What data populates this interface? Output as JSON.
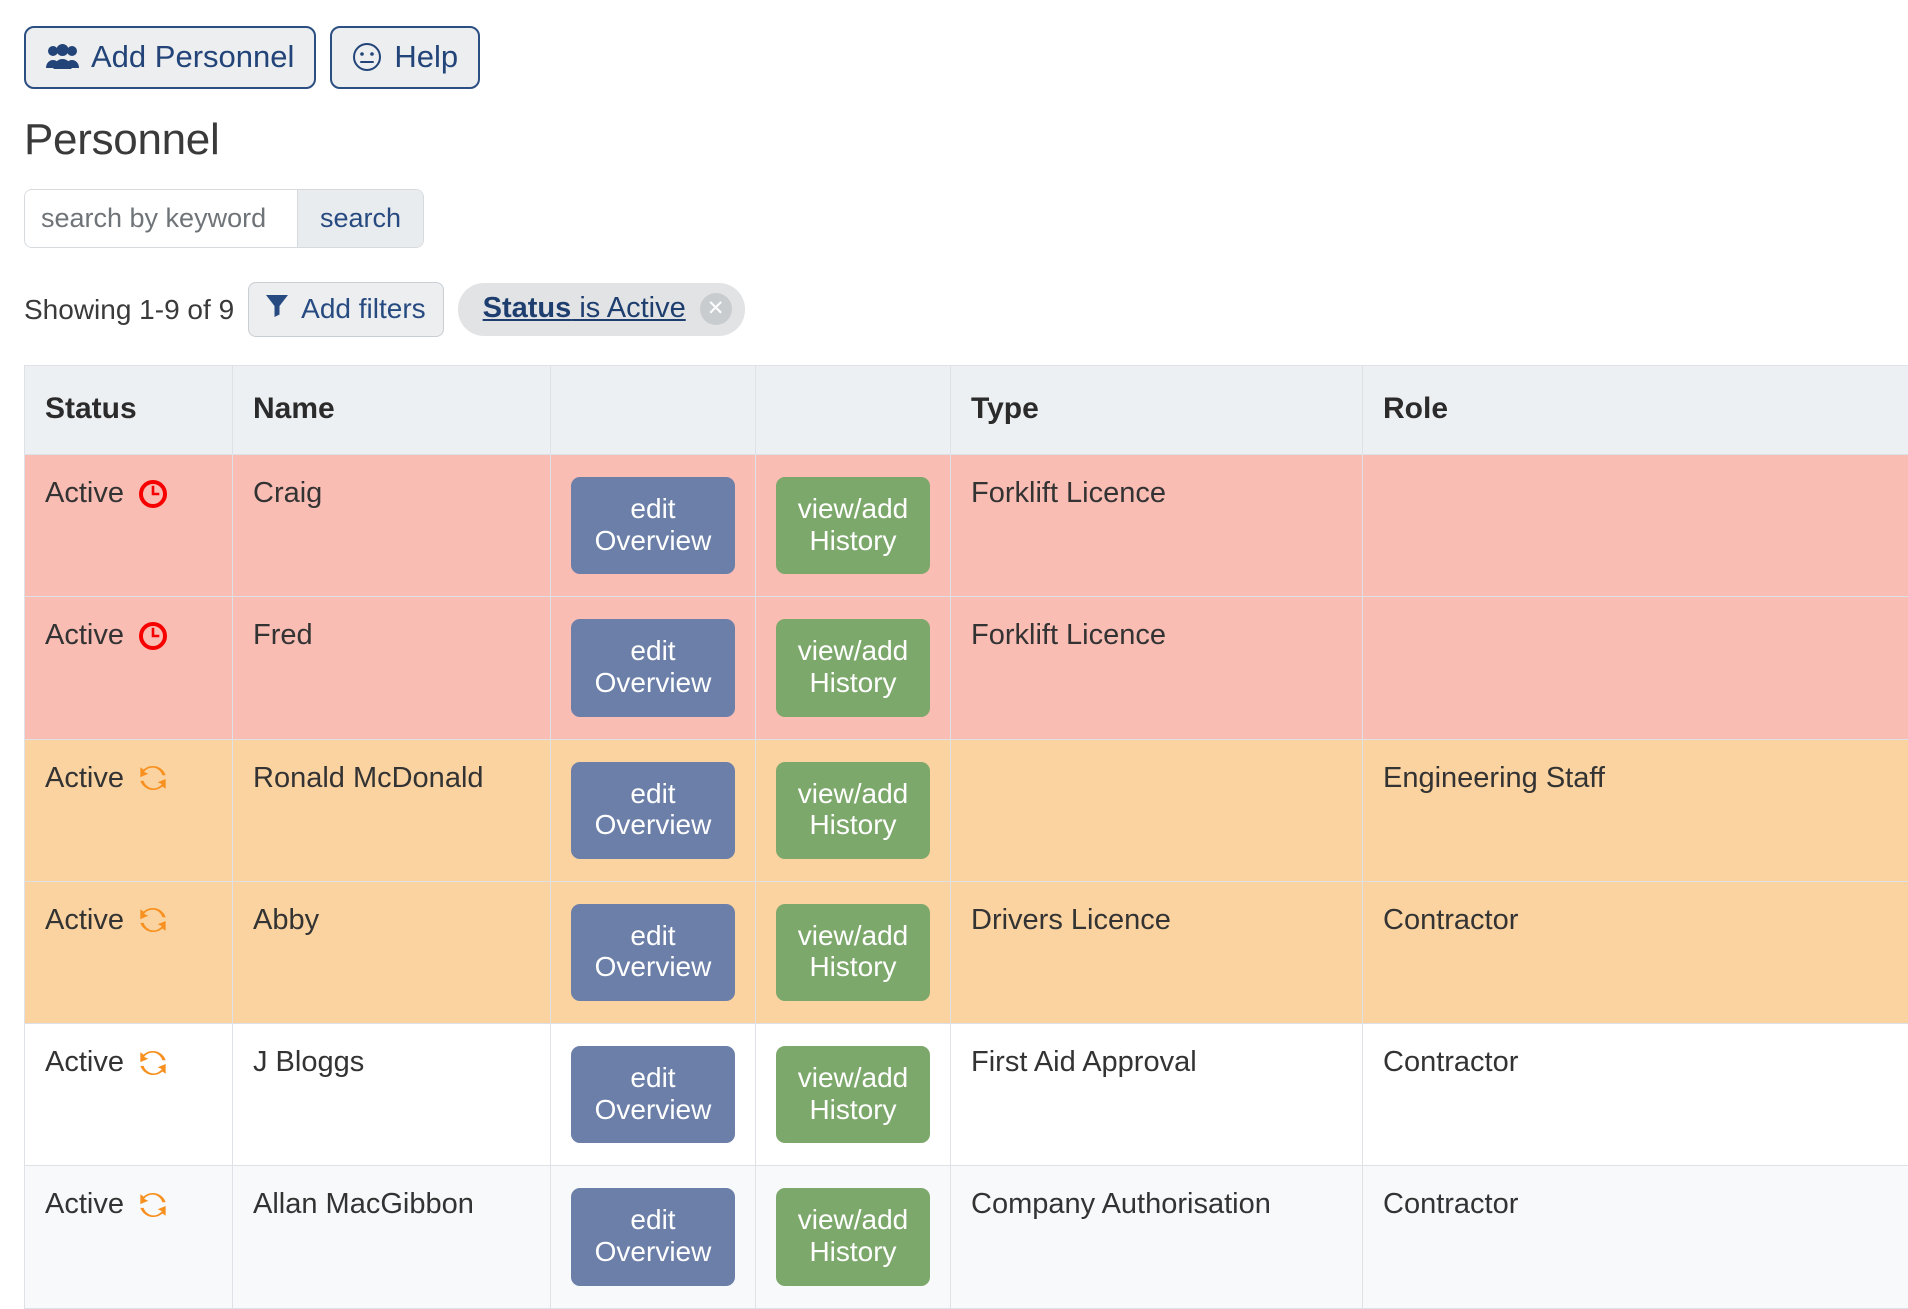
{
  "toolbar": {
    "add_personnel_label": "Add Personnel",
    "add_personnel_icon": "users-icon",
    "help_label": "Help",
    "help_icon": "smiley-face-icon"
  },
  "page": {
    "title": "Personnel"
  },
  "search": {
    "placeholder": "search by keyword",
    "value": "",
    "button_label": "search"
  },
  "filters": {
    "showing": "Showing 1-9 of 9",
    "add_filters_label": "Add filters",
    "add_filters_icon": "funnel-icon",
    "chips": [
      {
        "key": "Status",
        "rest": " is Active",
        "remove_label": "✕",
        "remove_icon": "close-circle-icon"
      }
    ]
  },
  "colors": {
    "accent_blue": "#274a80",
    "edit_button": "#6b7fa8",
    "history_button": "#7da86b",
    "row_overdue": "#f9bdb4",
    "row_due": "#fbd3a1",
    "header_bg": "#edf0f2",
    "overdue_icon": "#f70000",
    "due_icon": "#f7901e"
  },
  "table": {
    "columns": [
      {
        "label": "Status",
        "key": "status"
      },
      {
        "label": "Name",
        "key": "name"
      },
      {
        "label": "",
        "key": "edit"
      },
      {
        "label": "",
        "key": "history"
      },
      {
        "label": "Type",
        "key": "type"
      },
      {
        "label": "Role",
        "key": "role"
      }
    ],
    "edit_button_label": "edit\nOverview",
    "edit_button_line1": "edit",
    "edit_button_line2": "Overview",
    "history_button_line1": "view/add",
    "history_button_line2": "History",
    "rows": [
      {
        "status": "Active",
        "status_icon": "clock-icon",
        "status_icon_color": "#f70000",
        "name": "Craig",
        "type": "Forklift Licence",
        "role": "",
        "row_style": "r-red"
      },
      {
        "status": "Active",
        "status_icon": "clock-icon",
        "status_icon_color": "#f70000",
        "name": "Fred",
        "type": "Forklift Licence",
        "role": "",
        "row_style": "r-red"
      },
      {
        "status": "Active",
        "status_icon": "sync-icon",
        "status_icon_color": "#f7901e",
        "name": "Ronald McDonald",
        "type": "",
        "role": "Engineering Staff",
        "row_style": "r-org"
      },
      {
        "status": "Active",
        "status_icon": "sync-icon",
        "status_icon_color": "#f7901e",
        "name": "Abby",
        "type": "Drivers Licence",
        "role": "Contractor",
        "row_style": "r-org"
      },
      {
        "status": "Active",
        "status_icon": "sync-icon",
        "status_icon_color": "#f7901e",
        "name": "J Bloggs",
        "type": "First Aid Approval",
        "role": "Contractor",
        "row_style": "r-white"
      },
      {
        "status": "Active",
        "status_icon": "sync-icon",
        "status_icon_color": "#f7901e",
        "name": "Allan MacGibbon",
        "type": "Company Authorisation",
        "role": "Contractor",
        "row_style": "r-grey"
      }
    ]
  }
}
